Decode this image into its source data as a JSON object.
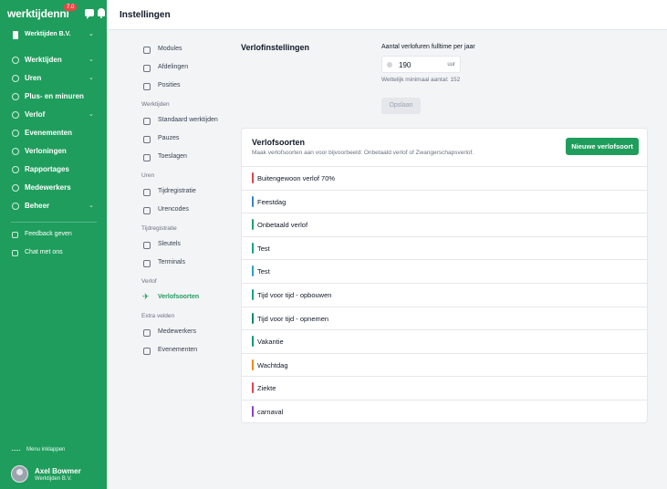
{
  "app": {
    "logo": "werktijdenni",
    "version_badge": "7.0"
  },
  "sidebar": {
    "company": "Werktijden B.V.",
    "items": [
      {
        "label": "Werktijden",
        "chevron": true
      },
      {
        "label": "Uren",
        "chevron": true
      },
      {
        "label": "Plus- en minuren",
        "chevron": false
      },
      {
        "label": "Verlof",
        "chevron": true
      },
      {
        "label": "Evenementen",
        "chevron": false
      },
      {
        "label": "Verloningen",
        "chevron": false
      },
      {
        "label": "Rapportages",
        "chevron": false
      },
      {
        "label": "Medewerkers",
        "chevron": false
      },
      {
        "label": "Beheer",
        "chevron": true
      }
    ],
    "secondary": [
      {
        "label": "Feedback geven"
      },
      {
        "label": "Chat met ons"
      }
    ],
    "collapse_label": "Menu inklappen",
    "user": {
      "name": "Axel Bowmer",
      "company": "Werktijden B.V."
    }
  },
  "header": {
    "title": "Instellingen"
  },
  "settings_nav": {
    "items": [
      {
        "type": "item",
        "label": "Modules"
      },
      {
        "type": "item",
        "label": "Afdelingen"
      },
      {
        "type": "item",
        "label": "Posities"
      },
      {
        "type": "section",
        "label": "Werktijden"
      },
      {
        "type": "item",
        "label": "Standaard werktijden"
      },
      {
        "type": "item",
        "label": "Pauzes"
      },
      {
        "type": "item",
        "label": "Toeslagen"
      },
      {
        "type": "section",
        "label": "Uren"
      },
      {
        "type": "item",
        "label": "Tijdregistratie"
      },
      {
        "type": "item",
        "label": "Urencodes"
      },
      {
        "type": "section",
        "label": "Tijdregistratie"
      },
      {
        "type": "item",
        "label": "Sleutels"
      },
      {
        "type": "item",
        "label": "Terminals"
      },
      {
        "type": "section",
        "label": "Verlof"
      },
      {
        "type": "item",
        "label": "Verlofsoorten",
        "active": true
      },
      {
        "type": "section",
        "label": "Extra velden"
      },
      {
        "type": "item",
        "label": "Medewerkers"
      },
      {
        "type": "item",
        "label": "Evenementen"
      }
    ]
  },
  "verlof_settings": {
    "title": "Verlofinstellingen",
    "hours_label": "Aantal verlofuren fulltime per jaar",
    "hours_value": "190",
    "hours_unit": "uur",
    "minimum_note": "Wettelijk minimaal aantal: 152",
    "save_label": "Opslaan"
  },
  "verlofsoorten": {
    "title": "Verlofsoorten",
    "subtitle": "Maak verlofsoorten aan voor bijvoorbeeld: Onbetaald verlof of Zwangerschapsverlof.",
    "new_button": "Nieuwe verlofsoort",
    "rows": [
      {
        "label": "Buitengewoon verlof 70%",
        "color": "#e0434b"
      },
      {
        "label": "Feestdag",
        "color": "#3b82c4"
      },
      {
        "label": "Onbetaald verlof",
        "color": "#22a06b"
      },
      {
        "label": "Test",
        "color": "#14a38b"
      },
      {
        "label": "Test",
        "color": "#2f9ec9"
      },
      {
        "label": "Tijd voor tijd - opbouwen",
        "color": "#14a38b"
      },
      {
        "label": "Tijd voor tijd - opnemen",
        "color": "#128a6e"
      },
      {
        "label": "Vakantie",
        "color": "#10967a"
      },
      {
        "label": "Wachtdag",
        "color": "#f08a1a"
      },
      {
        "label": "Ziekte",
        "color": "#e0434b"
      },
      {
        "label": "carnaval",
        "color": "#8b3fc9"
      }
    ]
  }
}
